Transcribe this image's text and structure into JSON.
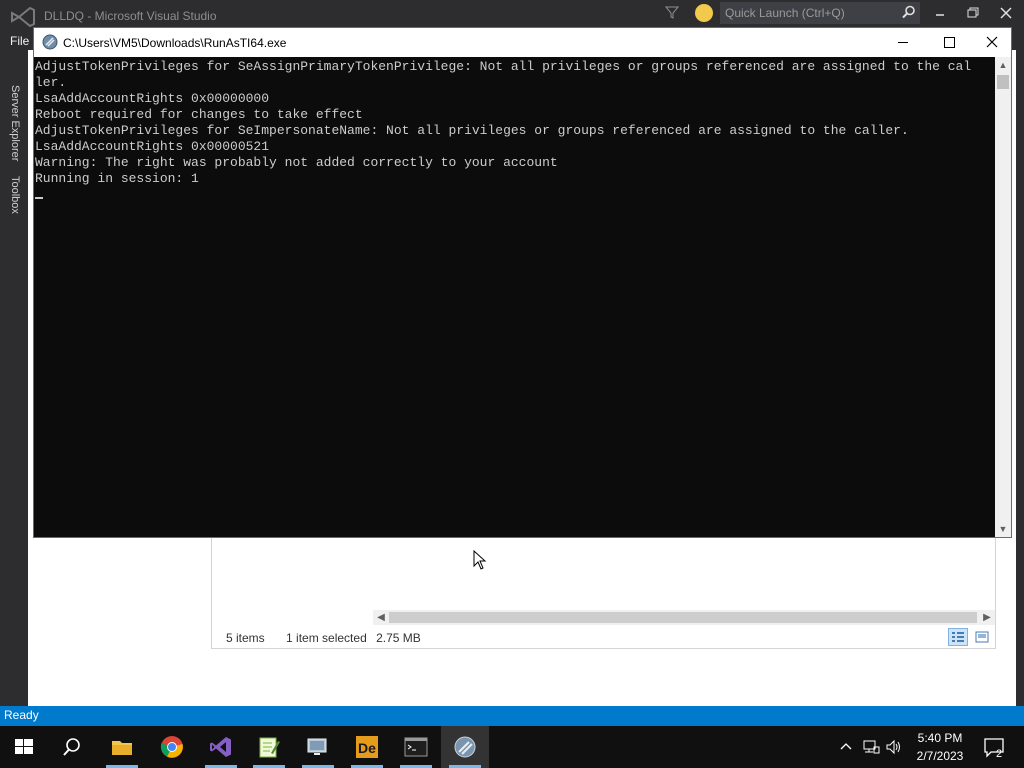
{
  "vs": {
    "title": "DLLDQ - Microsoft Visual Studio",
    "quick_launch": "Quick Launch (Ctrl+Q)",
    "menu_file": "File",
    "side_tabs": [
      "Server Explorer",
      "Toolbox"
    ],
    "status": "Ready"
  },
  "console": {
    "title": "C:\\Users\\VM5\\Downloads\\RunAsTI64.exe",
    "lines": [
      "AdjustTokenPrivileges for SeAssignPrimaryTokenPrivilege: Not all privileges or groups referenced are assigned to the cal",
      "ler.",
      "LsaAddAccountRights 0x00000000",
      "Reboot required for changes to take effect",
      "AdjustTokenPrivileges for SeImpersonateName: Not all privileges or groups referenced are assigned to the caller.",
      "LsaAddAccountRights 0x00000521",
      "Warning: The right was probably not added correctly to your account",
      "Running in session: 1"
    ]
  },
  "explorer": {
    "items_count": "5 items",
    "selected": "1 item selected",
    "size": "2.75 MB"
  },
  "taskbar": {
    "time": "5:40 PM",
    "date": "2/7/2023",
    "notification_count": "2",
    "icons": [
      "windows-start-icon",
      "search-icon",
      "file-explorer-icon",
      "chrome-icon",
      "visual-studio-icon",
      "notepad-plus-plus-icon",
      "remote-desktop-icon",
      "dependency-walker-icon",
      "command-prompt-icon",
      "runasti-icon"
    ]
  },
  "colors": {
    "console_bg": "#0c0c0c",
    "console_text": "#cccccc",
    "vs_status": "#007acc",
    "vs_chrome": "#2d2d30",
    "taskbar": "#101010"
  }
}
